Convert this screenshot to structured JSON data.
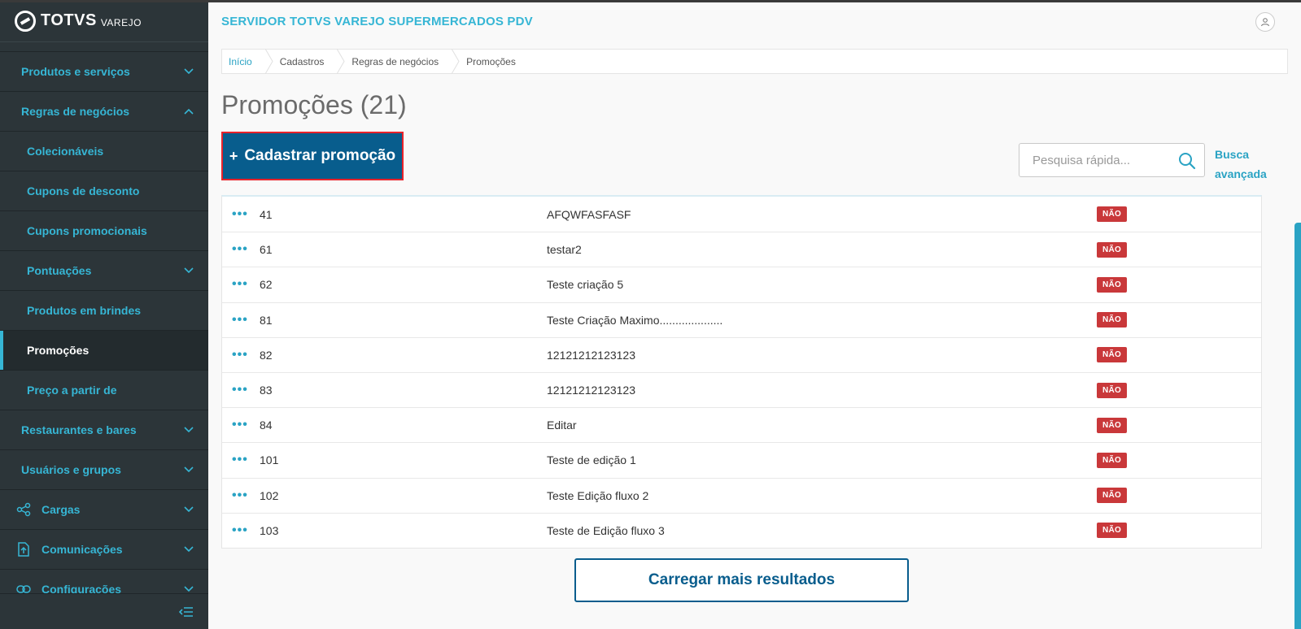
{
  "brand": {
    "name": "TOTVS",
    "sub": "VAREJO"
  },
  "header": {
    "server_title": "SERVIDOR TOTVS VAREJO SUPERMERCADOS PDV"
  },
  "sidebar": {
    "items": [
      {
        "label": "Produtos e serviços"
      },
      {
        "label": "Regras de negócios"
      },
      {
        "label": "Colecionáveis"
      },
      {
        "label": "Cupons de desconto"
      },
      {
        "label": "Cupons promocionais"
      },
      {
        "label": "Pontuações"
      },
      {
        "label": "Produtos em brindes"
      },
      {
        "label": "Promoções"
      },
      {
        "label": "Preço a partir de"
      },
      {
        "label": "Restaurantes e bares"
      },
      {
        "label": "Usuários e grupos"
      },
      {
        "label": "Cargas"
      },
      {
        "label": "Comunicações"
      },
      {
        "label": "Configurações"
      }
    ]
  },
  "breadcrumb": [
    "Início",
    "Cadastros",
    "Regras de negócios",
    "Promoções"
  ],
  "page": {
    "title": "Promoções (21)"
  },
  "actions": {
    "add_label": "Cadastrar promoção",
    "add_plus": "+"
  },
  "search": {
    "placeholder": "Pesquisa rápida...",
    "advanced_label": "Busca avançada"
  },
  "table": {
    "rows": [
      {
        "menu": "•••",
        "id": "41",
        "name": "AFQWFASFASF",
        "status": "NÃO"
      },
      {
        "menu": "•••",
        "id": "61",
        "name": "testar2",
        "status": "NÃO"
      },
      {
        "menu": "•••",
        "id": "62",
        "name": "Teste criação 5",
        "status": "NÃO"
      },
      {
        "menu": "•••",
        "id": "81",
        "name": "Teste Criação Maximo....................",
        "status": "NÃO"
      },
      {
        "menu": "•••",
        "id": "82",
        "name": "12121212123123",
        "status": "NÃO"
      },
      {
        "menu": "•••",
        "id": "83",
        "name": "12121212123123",
        "status": "NÃO"
      },
      {
        "menu": "•••",
        "id": "84",
        "name": "Editar",
        "status": "NÃO"
      },
      {
        "menu": "•••",
        "id": "101",
        "name": "Teste de edição 1",
        "status": "NÃO"
      },
      {
        "menu": "•••",
        "id": "102",
        "name": "Teste Edição fluxo 2",
        "status": "NÃO"
      },
      {
        "menu": "•••",
        "id": "103",
        "name": "Teste de Edição fluxo 3",
        "status": "NÃO"
      }
    ]
  },
  "footer": {
    "load_more_label": "Carregar mais resultados"
  },
  "colors": {
    "accent": "#36b6d5",
    "primary": "#085d8d",
    "badge": "#c9383a",
    "sidebar_bg": "#2c3539"
  }
}
